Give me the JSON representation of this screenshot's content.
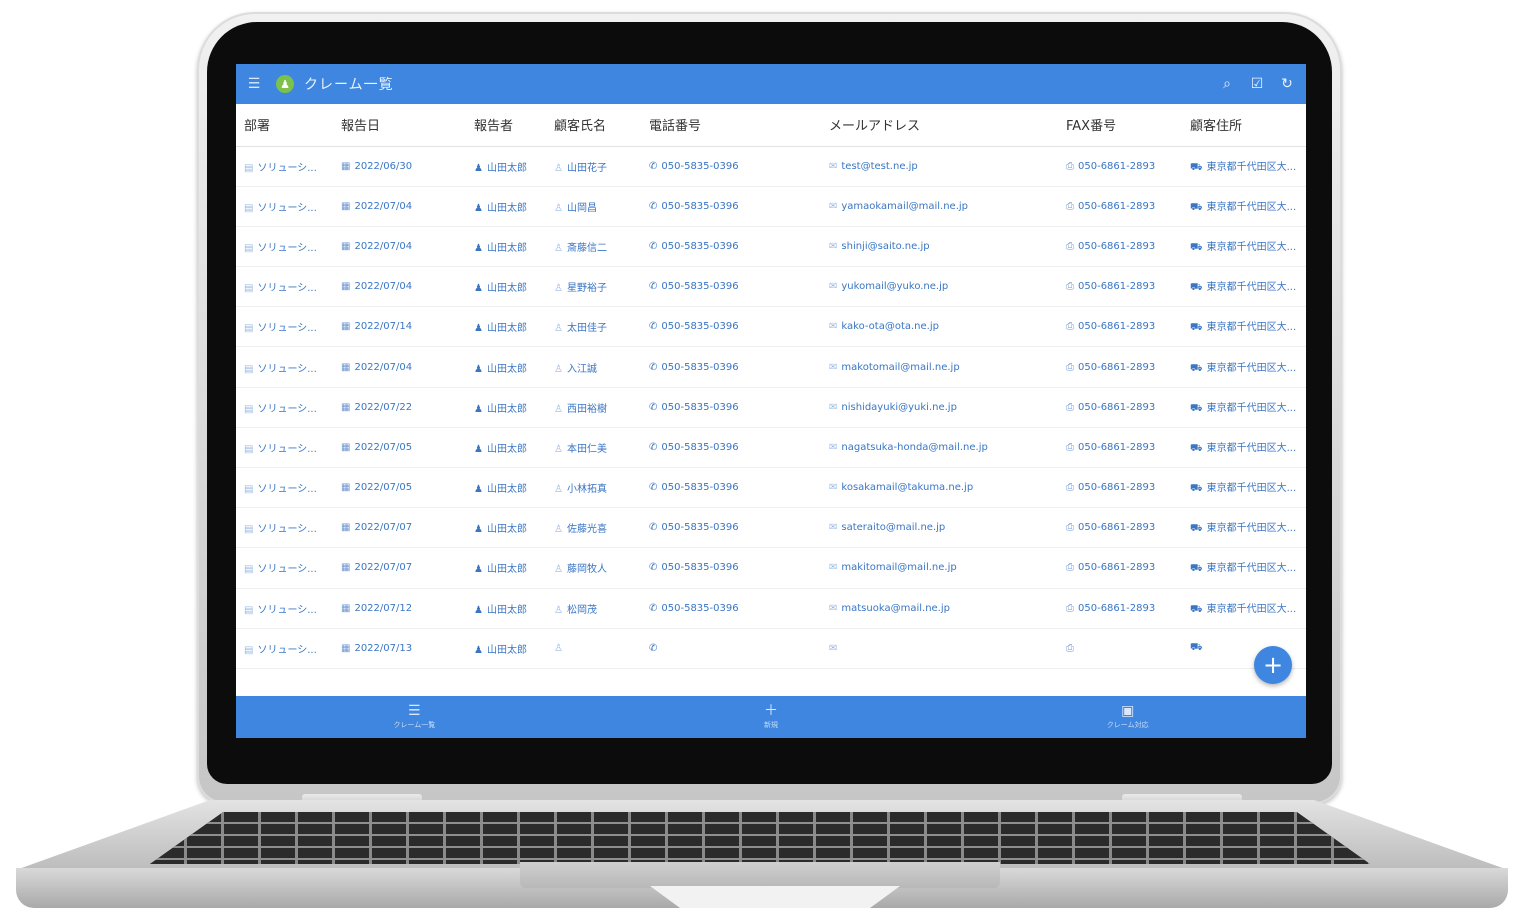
{
  "appbar": {
    "title": "クレーム一覧",
    "menu_icon": "menu-icon",
    "logo_icon": "app-logo-icon",
    "actions": [
      "search-icon",
      "check-box-icon",
      "refresh-icon"
    ]
  },
  "table": {
    "columns": [
      "部署",
      "報告日",
      "報告者",
      "顧客氏名",
      "電話番号",
      "メールアドレス",
      "FAX番号",
      "顧客住所"
    ],
    "rows": [
      [
        "ソリューシ...",
        "2022/06/30",
        "山田太郎",
        "山田花子",
        "050-5835-0396",
        "test@test.ne.jp",
        "050-6861-2893",
        "東京都千代田区大..."
      ],
      [
        "ソリューシ...",
        "2022/07/04",
        "山田太郎",
        "山岡昌",
        "050-5835-0396",
        "yamaokamail@mail.ne.jp",
        "050-6861-2893",
        "東京都千代田区大..."
      ],
      [
        "ソリューシ...",
        "2022/07/04",
        "山田太郎",
        "斎藤信二",
        "050-5835-0396",
        "shinji@saito.ne.jp",
        "050-6861-2893",
        "東京都千代田区大..."
      ],
      [
        "ソリューシ...",
        "2022/07/04",
        "山田太郎",
        "星野裕子",
        "050-5835-0396",
        "yukomail@yuko.ne.jp",
        "050-6861-2893",
        "東京都千代田区大..."
      ],
      [
        "ソリューシ...",
        "2022/07/14",
        "山田太郎",
        "太田佳子",
        "050-5835-0396",
        "kako-ota@ota.ne.jp",
        "050-6861-2893",
        "東京都千代田区大..."
      ],
      [
        "ソリューシ...",
        "2022/07/04",
        "山田太郎",
        "入江誠",
        "050-5835-0396",
        "makotomail@mail.ne.jp",
        "050-6861-2893",
        "東京都千代田区大..."
      ],
      [
        "ソリューシ...",
        "2022/07/22",
        "山田太郎",
        "西田裕樹",
        "050-5835-0396",
        "nishidayuki@yuki.ne.jp",
        "050-6861-2893",
        "東京都千代田区大..."
      ],
      [
        "ソリューシ...",
        "2022/07/05",
        "山田太郎",
        "本田仁美",
        "050-5835-0396",
        "nagatsuka-honda@mail.ne.jp",
        "050-6861-2893",
        "東京都千代田区大..."
      ],
      [
        "ソリューシ...",
        "2022/07/05",
        "山田太郎",
        "小林拓真",
        "050-5835-0396",
        "kosakamail@takuma.ne.jp",
        "050-6861-2893",
        "東京都千代田区大..."
      ],
      [
        "ソリューシ...",
        "2022/07/07",
        "山田太郎",
        "佐藤光喜",
        "050-5835-0396",
        "sateraito@mail.ne.jp",
        "050-6861-2893",
        "東京都千代田区大..."
      ],
      [
        "ソリューシ...",
        "2022/07/07",
        "山田太郎",
        "藤岡牧人",
        "050-5835-0396",
        "makitomail@mail.ne.jp",
        "050-6861-2893",
        "東京都千代田区大..."
      ],
      [
        "ソリューシ...",
        "2022/07/12",
        "山田太郎",
        "松岡茂",
        "050-5835-0396",
        "matsuoka@mail.ne.jp",
        "050-6861-2893",
        "東京都千代田区大..."
      ],
      [
        "ソリューシ...",
        "2022/07/13",
        "山田太郎",
        "",
        "",
        "",
        "",
        ""
      ]
    ]
  },
  "fab": {
    "label": "+"
  },
  "bottomnav": [
    {
      "icon": "list-icon",
      "label": "クレーム一覧"
    },
    {
      "icon": "add-icon",
      "label": "新規"
    },
    {
      "icon": "feedback-icon",
      "label": "クレーム対応"
    }
  ],
  "colors": {
    "primary": "#3f86e0",
    "link": "#3a76c4"
  }
}
